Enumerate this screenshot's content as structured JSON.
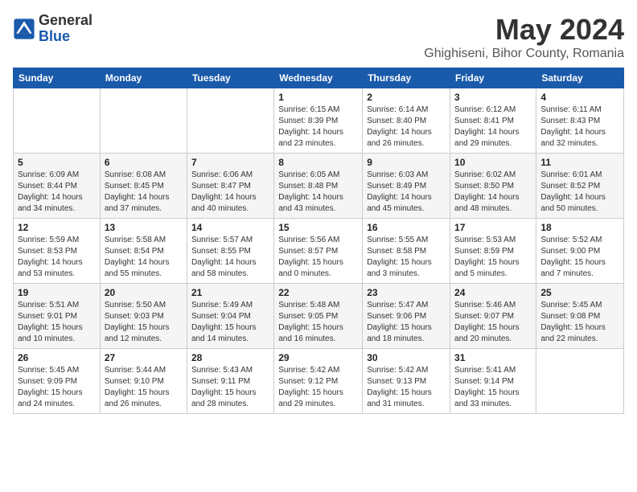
{
  "logo": {
    "general": "General",
    "blue": "Blue"
  },
  "title": {
    "month": "May 2024",
    "location": "Ghighiseni, Bihor County, Romania"
  },
  "weekdays": [
    "Sunday",
    "Monday",
    "Tuesday",
    "Wednesday",
    "Thursday",
    "Friday",
    "Saturday"
  ],
  "weeks": [
    [
      {
        "day": "",
        "info": ""
      },
      {
        "day": "",
        "info": ""
      },
      {
        "day": "",
        "info": ""
      },
      {
        "day": "1",
        "info": "Sunrise: 6:15 AM\nSunset: 8:39 PM\nDaylight: 14 hours\nand 23 minutes."
      },
      {
        "day": "2",
        "info": "Sunrise: 6:14 AM\nSunset: 8:40 PM\nDaylight: 14 hours\nand 26 minutes."
      },
      {
        "day": "3",
        "info": "Sunrise: 6:12 AM\nSunset: 8:41 PM\nDaylight: 14 hours\nand 29 minutes."
      },
      {
        "day": "4",
        "info": "Sunrise: 6:11 AM\nSunset: 8:43 PM\nDaylight: 14 hours\nand 32 minutes."
      }
    ],
    [
      {
        "day": "5",
        "info": "Sunrise: 6:09 AM\nSunset: 8:44 PM\nDaylight: 14 hours\nand 34 minutes."
      },
      {
        "day": "6",
        "info": "Sunrise: 6:08 AM\nSunset: 8:45 PM\nDaylight: 14 hours\nand 37 minutes."
      },
      {
        "day": "7",
        "info": "Sunrise: 6:06 AM\nSunset: 8:47 PM\nDaylight: 14 hours\nand 40 minutes."
      },
      {
        "day": "8",
        "info": "Sunrise: 6:05 AM\nSunset: 8:48 PM\nDaylight: 14 hours\nand 43 minutes."
      },
      {
        "day": "9",
        "info": "Sunrise: 6:03 AM\nSunset: 8:49 PM\nDaylight: 14 hours\nand 45 minutes."
      },
      {
        "day": "10",
        "info": "Sunrise: 6:02 AM\nSunset: 8:50 PM\nDaylight: 14 hours\nand 48 minutes."
      },
      {
        "day": "11",
        "info": "Sunrise: 6:01 AM\nSunset: 8:52 PM\nDaylight: 14 hours\nand 50 minutes."
      }
    ],
    [
      {
        "day": "12",
        "info": "Sunrise: 5:59 AM\nSunset: 8:53 PM\nDaylight: 14 hours\nand 53 minutes."
      },
      {
        "day": "13",
        "info": "Sunrise: 5:58 AM\nSunset: 8:54 PM\nDaylight: 14 hours\nand 55 minutes."
      },
      {
        "day": "14",
        "info": "Sunrise: 5:57 AM\nSunset: 8:55 PM\nDaylight: 14 hours\nand 58 minutes."
      },
      {
        "day": "15",
        "info": "Sunrise: 5:56 AM\nSunset: 8:57 PM\nDaylight: 15 hours\nand 0 minutes."
      },
      {
        "day": "16",
        "info": "Sunrise: 5:55 AM\nSunset: 8:58 PM\nDaylight: 15 hours\nand 3 minutes."
      },
      {
        "day": "17",
        "info": "Sunrise: 5:53 AM\nSunset: 8:59 PM\nDaylight: 15 hours\nand 5 minutes."
      },
      {
        "day": "18",
        "info": "Sunrise: 5:52 AM\nSunset: 9:00 PM\nDaylight: 15 hours\nand 7 minutes."
      }
    ],
    [
      {
        "day": "19",
        "info": "Sunrise: 5:51 AM\nSunset: 9:01 PM\nDaylight: 15 hours\nand 10 minutes."
      },
      {
        "day": "20",
        "info": "Sunrise: 5:50 AM\nSunset: 9:03 PM\nDaylight: 15 hours\nand 12 minutes."
      },
      {
        "day": "21",
        "info": "Sunrise: 5:49 AM\nSunset: 9:04 PM\nDaylight: 15 hours\nand 14 minutes."
      },
      {
        "day": "22",
        "info": "Sunrise: 5:48 AM\nSunset: 9:05 PM\nDaylight: 15 hours\nand 16 minutes."
      },
      {
        "day": "23",
        "info": "Sunrise: 5:47 AM\nSunset: 9:06 PM\nDaylight: 15 hours\nand 18 minutes."
      },
      {
        "day": "24",
        "info": "Sunrise: 5:46 AM\nSunset: 9:07 PM\nDaylight: 15 hours\nand 20 minutes."
      },
      {
        "day": "25",
        "info": "Sunrise: 5:45 AM\nSunset: 9:08 PM\nDaylight: 15 hours\nand 22 minutes."
      }
    ],
    [
      {
        "day": "26",
        "info": "Sunrise: 5:45 AM\nSunset: 9:09 PM\nDaylight: 15 hours\nand 24 minutes."
      },
      {
        "day": "27",
        "info": "Sunrise: 5:44 AM\nSunset: 9:10 PM\nDaylight: 15 hours\nand 26 minutes."
      },
      {
        "day": "28",
        "info": "Sunrise: 5:43 AM\nSunset: 9:11 PM\nDaylight: 15 hours\nand 28 minutes."
      },
      {
        "day": "29",
        "info": "Sunrise: 5:42 AM\nSunset: 9:12 PM\nDaylight: 15 hours\nand 29 minutes."
      },
      {
        "day": "30",
        "info": "Sunrise: 5:42 AM\nSunset: 9:13 PM\nDaylight: 15 hours\nand 31 minutes."
      },
      {
        "day": "31",
        "info": "Sunrise: 5:41 AM\nSunset: 9:14 PM\nDaylight: 15 hours\nand 33 minutes."
      },
      {
        "day": "",
        "info": ""
      }
    ]
  ]
}
